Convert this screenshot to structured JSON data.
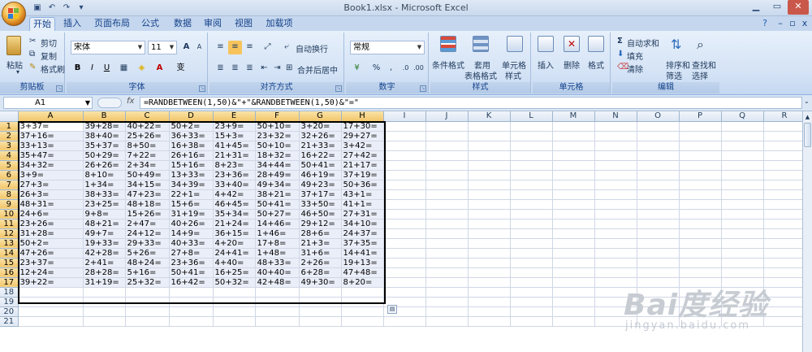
{
  "window": {
    "title": "Book1.xlsx - Microsoft Excel"
  },
  "tabs": [
    "开始",
    "插入",
    "页面布局",
    "公式",
    "数据",
    "审阅",
    "视图",
    "加载项"
  ],
  "ribbon": {
    "clipboard": {
      "label": "剪贴板",
      "paste": "粘贴",
      "cut": "剪切",
      "copy": "复制",
      "format_painter": "格式刷"
    },
    "font": {
      "label": "字体",
      "name": "宋体",
      "size": "11",
      "grow": "A",
      "shrink": "A",
      "bold": "B",
      "italic": "I",
      "underline": "U",
      "wen": "变"
    },
    "alignment": {
      "label": "对齐方式",
      "wrap": "自动换行",
      "merge": "合并后居中"
    },
    "number": {
      "label": "数字",
      "format": "常规",
      "percent": "%",
      "comma": ","
    },
    "styles": {
      "label": "样式",
      "conditional": "条件格式",
      "table_format_1": "套用",
      "table_format_2": "表格格式",
      "cell_style_1": "单元格",
      "cell_style_2": "样式"
    },
    "cells": {
      "label": "单元格",
      "insert": "插入",
      "delete": "删除",
      "format": "格式"
    },
    "editing": {
      "label": "编辑",
      "autosum": "自动求和",
      "fill": "填充",
      "clear": "清除",
      "sort_1": "排序和",
      "sort_2": "筛选",
      "find_1": "查找和",
      "find_2": "选择"
    }
  },
  "formula_bar": {
    "name_box": "A1",
    "fx": "fx",
    "formula": "=RANDBETWEEN(1,50)&\"+\"&RANDBETWEEN(1,50)&\"=\""
  },
  "columns": [
    "A",
    "B",
    "C",
    "D",
    "E",
    "F",
    "G",
    "H",
    "I",
    "J",
    "K",
    "L",
    "M",
    "N",
    "O",
    "P",
    "Q",
    "R"
  ],
  "rows": [
    "1",
    "2",
    "3",
    "4",
    "5",
    "6",
    "7",
    "8",
    "9",
    "10",
    "11",
    "12",
    "13",
    "14",
    "15",
    "16",
    "17",
    "18",
    "19",
    "20",
    "21"
  ],
  "cells": [
    [
      "3+37=",
      "39+28=",
      "40+22=",
      "50+2=",
      "23+9=",
      "50+10=",
      "3+20=",
      "17+30="
    ],
    [
      "37+16=",
      "38+40=",
      "25+26=",
      "36+33=",
      "15+3=",
      "23+32=",
      "32+26=",
      "29+27="
    ],
    [
      "33+13=",
      "35+37=",
      "8+50=",
      "16+38=",
      "41+45=",
      "50+10=",
      "21+33=",
      "3+42="
    ],
    [
      "35+47=",
      "50+29=",
      "7+22=",
      "26+16=",
      "21+31=",
      "18+32=",
      "16+22=",
      "27+42="
    ],
    [
      "34+32=",
      "26+26=",
      "2+34=",
      "15+16=",
      "8+23=",
      "34+44=",
      "50+41=",
      "21+17="
    ],
    [
      "3+9=",
      "8+10=",
      "50+49=",
      "13+33=",
      "23+36=",
      "28+49=",
      "46+19=",
      "37+19="
    ],
    [
      "27+3=",
      "1+34=",
      "34+15=",
      "34+39=",
      "33+40=",
      "49+34=",
      "49+23=",
      "50+36="
    ],
    [
      "26+3=",
      "38+33=",
      "47+23=",
      "22+1=",
      "4+42=",
      "38+21=",
      "37+17=",
      "43+1="
    ],
    [
      "48+31=",
      "23+25=",
      "48+18=",
      "15+6=",
      "46+45=",
      "50+41=",
      "33+50=",
      "41+1="
    ],
    [
      "24+6=",
      "9+8=",
      "15+26=",
      "31+19=",
      "35+34=",
      "50+27=",
      "46+50=",
      "27+31="
    ],
    [
      "23+26=",
      "48+21=",
      "2+47=",
      "40+26=",
      "21+24=",
      "14+46=",
      "29+12=",
      "34+10="
    ],
    [
      "31+28=",
      "49+7=",
      "24+12=",
      "14+9=",
      "36+15=",
      "1+46=",
      "28+6=",
      "24+37="
    ],
    [
      "50+2=",
      "19+33=",
      "29+33=",
      "40+33=",
      "4+20=",
      "17+8=",
      "21+3=",
      "37+35="
    ],
    [
      "47+26=",
      "42+28=",
      "5+26=",
      "27+8=",
      "24+41=",
      "1+48=",
      "31+6=",
      "14+41="
    ],
    [
      "23+37=",
      "2+41=",
      "48+24=",
      "23+36=",
      "4+40=",
      "48+33=",
      "2+26=",
      "19+13="
    ],
    [
      "12+24=",
      "28+28=",
      "5+16=",
      "50+41=",
      "16+25=",
      "40+40=",
      "6+28=",
      "47+48="
    ],
    [
      "39+22=",
      "31+19=",
      "25+32=",
      "16+42=",
      "50+32=",
      "42+48=",
      "49+30=",
      "8+20="
    ]
  ],
  "watermark": {
    "line1": "Bai度经验",
    "line2": "jingyan.baidu.com"
  }
}
